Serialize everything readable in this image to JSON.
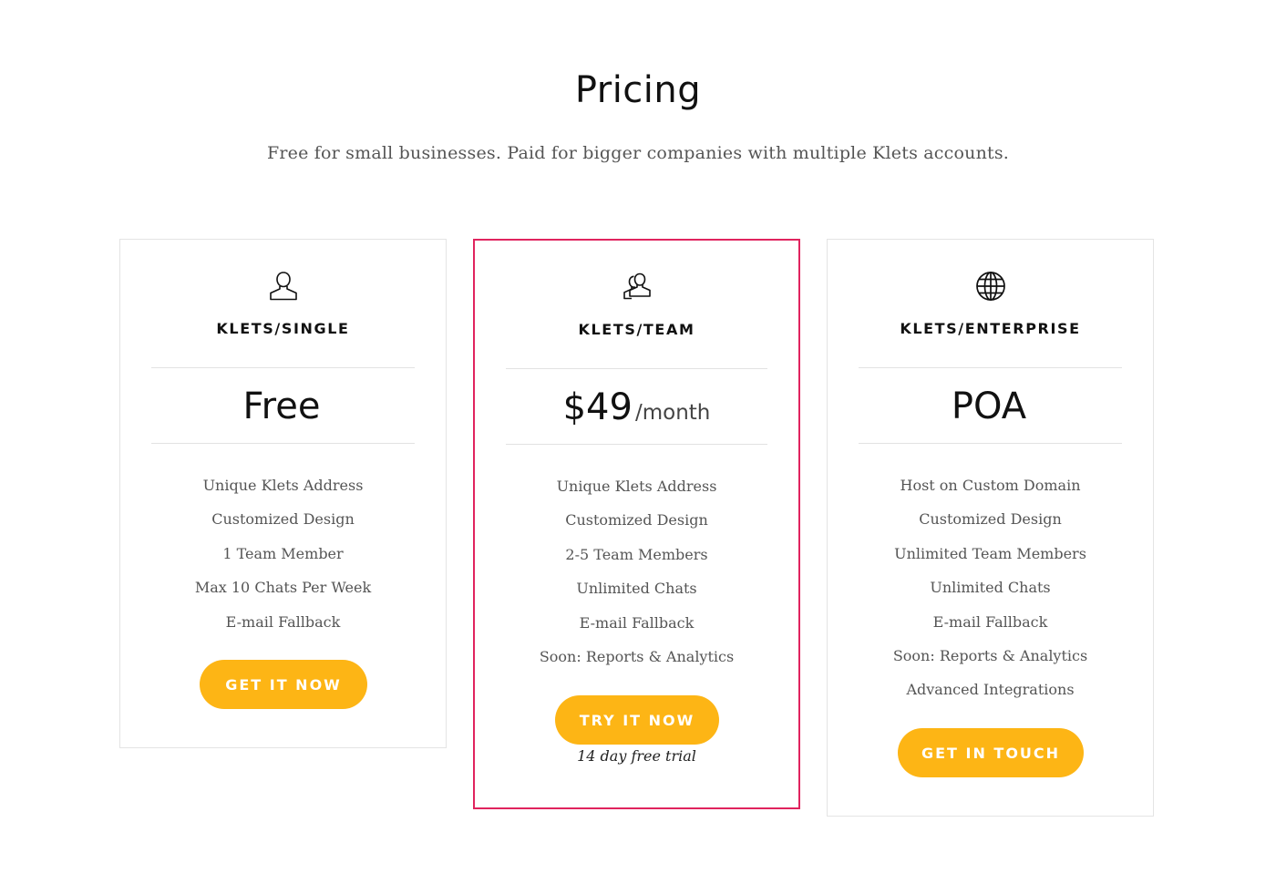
{
  "header": {
    "title": "Pricing",
    "subtitle": "Free for small businesses. Paid for bigger companies with multiple Klets accounts."
  },
  "plans": [
    {
      "icon": "user-icon",
      "name": "KLETS/SINGLE",
      "price": "Free",
      "period": "",
      "features": [
        "Unique Klets Address",
        "Customized Design",
        "1 Team Member",
        "Max 10 Chats Per Week",
        "E-mail Fallback"
      ],
      "cta": "GET IT NOW",
      "note": ""
    },
    {
      "icon": "users-icon",
      "name": "KLETS/TEAM",
      "price": "$49",
      "period": "/month",
      "features": [
        "Unique Klets Address",
        "Customized Design",
        "2-5 Team Members",
        "Unlimited Chats",
        "E-mail Fallback",
        "Soon: Reports & Analytics"
      ],
      "cta": "TRY IT NOW",
      "note": "14 day free trial",
      "highlighted": true
    },
    {
      "icon": "globe-icon",
      "name": "KLETS/ENTERPRISE",
      "price": "POA",
      "period": "",
      "features": [
        "Host on Custom Domain",
        "Customized Design",
        "Unlimited Team Members",
        "Unlimited Chats",
        "E-mail Fallback",
        "Soon: Reports & Analytics",
        "Advanced Integrations"
      ],
      "cta": "GET IN TOUCH",
      "note": ""
    }
  ],
  "colors": {
    "accent": "#fdb515",
    "highlight_border": "#e0245e",
    "card_border": "#e4e4e4"
  }
}
